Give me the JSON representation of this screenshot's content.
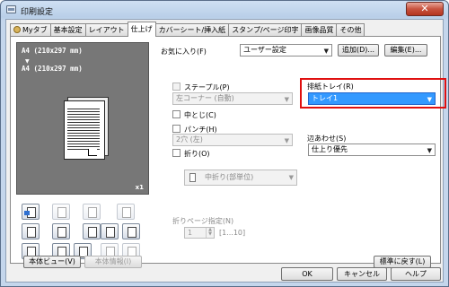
{
  "window": {
    "title": "印刷設定",
    "close_label": "✕"
  },
  "tabs": [
    {
      "label": "Myタブ"
    },
    {
      "label": "基本設定"
    },
    {
      "label": "レイアウト"
    },
    {
      "label": "仕上げ"
    },
    {
      "label": "カバーシート/挿入紙"
    },
    {
      "label": "スタンプ/ページ印字"
    },
    {
      "label": "画像品質"
    },
    {
      "label": "その他"
    }
  ],
  "preview": {
    "paper_size_1": "A4 (210x297 mm)",
    "arrow": "▼",
    "paper_size_2": "A4 (210x297 mm)",
    "copies": "x1"
  },
  "favorites": {
    "label": "お気に入り(F)",
    "value": "ユーザー設定",
    "add_button": "追加(D)...",
    "edit_button": "編集(E)..."
  },
  "staple": {
    "label": "ステープル(P)",
    "value": "左コーナー (自動)"
  },
  "center_staple": {
    "label": "中とじ(C)"
  },
  "punch": {
    "label": "パンチ(H)",
    "value": "2穴 (左)"
  },
  "fold": {
    "label": "折り(O)",
    "value": "中折り(部単位)"
  },
  "output_tray": {
    "label": "排紙トレイ(R)",
    "value": "トレイ1"
  },
  "binding": {
    "label": "辺あわせ(S)",
    "value": "仕上り優先"
  },
  "fold_pages": {
    "label": "折りページ指定(N)",
    "value": "1",
    "range": "[1...10]"
  },
  "left_buttons": {
    "body_view": "本体ビュー(V)",
    "body_info": "本体情報(I)"
  },
  "reset_button": "標準に戻す(L)",
  "footer": {
    "ok": "OK",
    "cancel": "キャンセル",
    "help": "ヘルプ"
  }
}
